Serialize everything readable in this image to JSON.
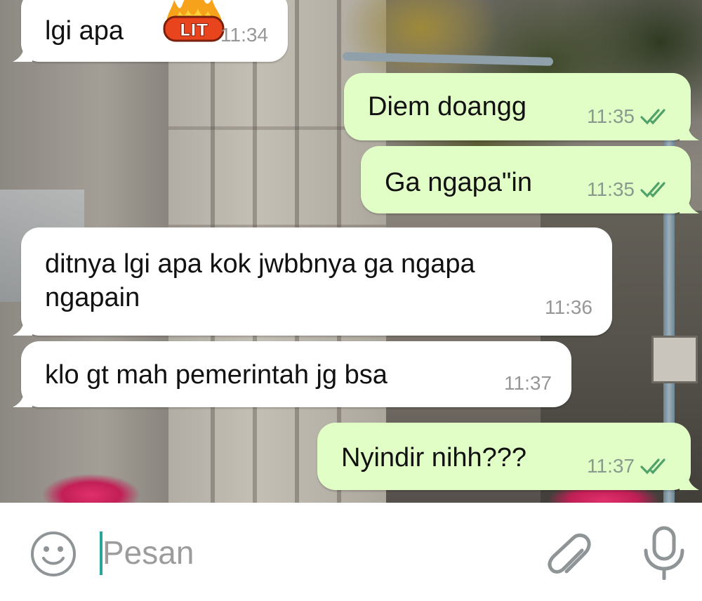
{
  "colors": {
    "incoming_bubble": "#ffffff",
    "outgoing_bubble": "#e1fec6",
    "read_tick": "#4fa368",
    "cursor": "#26a5a0"
  },
  "messages": [
    {
      "direction": "in",
      "text": "lgi apa",
      "sticker": "LIT",
      "time": "11:34"
    },
    {
      "direction": "out",
      "text": "Diem doangg",
      "time": "11:35",
      "status": "read"
    },
    {
      "direction": "out",
      "text": "Ga ngapa\"in",
      "time": "11:35",
      "status": "read"
    },
    {
      "direction": "in",
      "lines": [
        "ditnya lgi apa kok jwbbnya ga ngapa",
        "ngapain"
      ],
      "time": "11:36"
    },
    {
      "direction": "in",
      "text": "klo gt mah pemerintah jg bsa",
      "time": "11:37"
    },
    {
      "direction": "out",
      "text": "Nyindir nihh???",
      "time": "11:37",
      "status": "read"
    }
  ],
  "input": {
    "placeholder": "Pesan",
    "emoji_icon": "emoji-icon",
    "attach_icon": "paperclip-icon",
    "mic_icon": "microphone-icon"
  }
}
